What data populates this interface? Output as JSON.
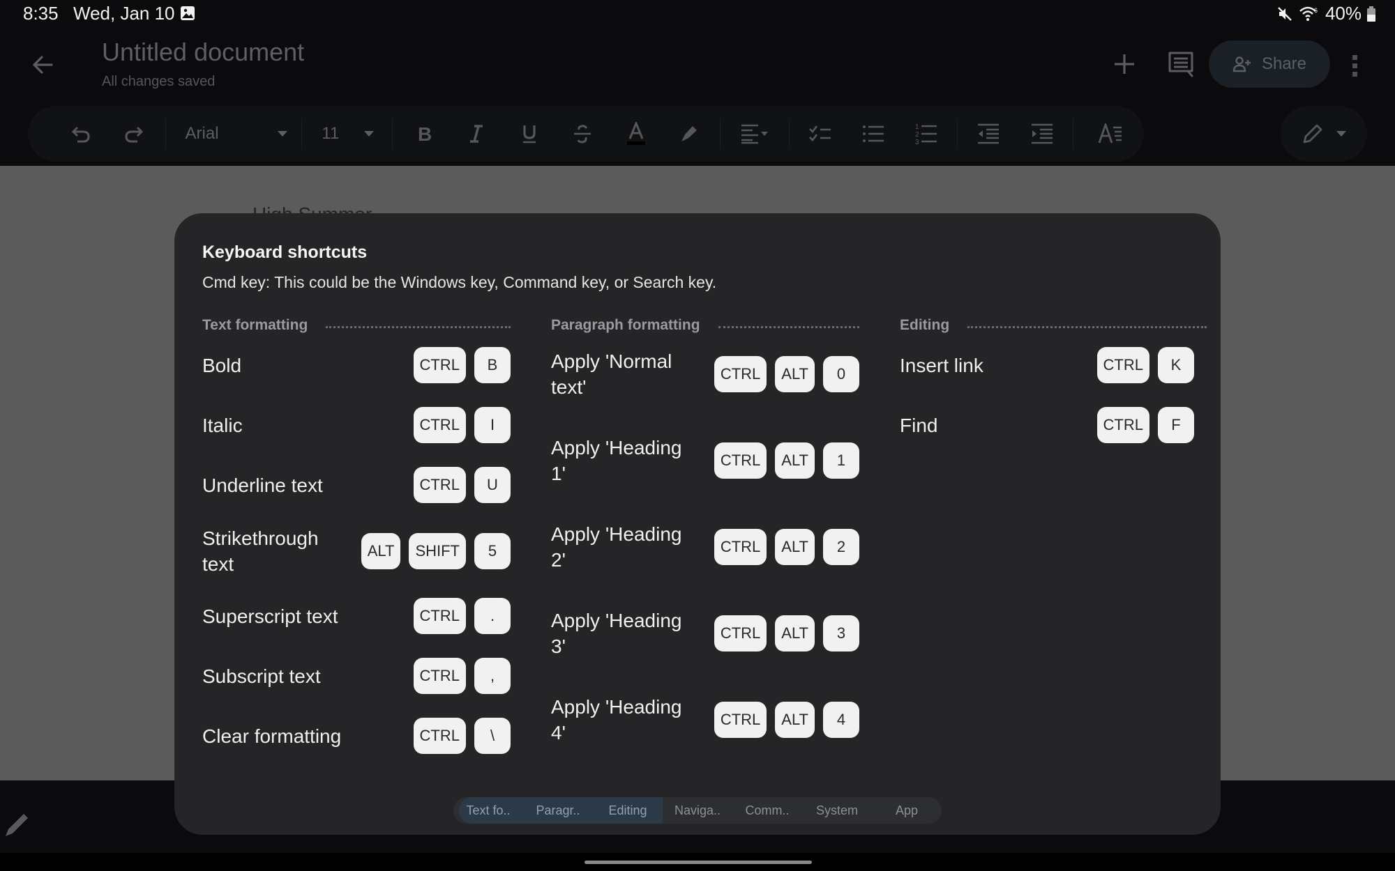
{
  "status_bar": {
    "time": "8:35",
    "date": "Wed, Jan 10",
    "notification_icon": "gallery-icon",
    "mute_icon": "mute-icon",
    "wifi_icon": "wifi-6-icon",
    "battery": "40%"
  },
  "app_bar": {
    "title": "Untitled document",
    "save_status": "All changes saved",
    "share_label": "Share"
  },
  "toolbar": {
    "font": "Arial",
    "font_size": "11",
    "buttons": [
      "undo",
      "redo",
      "bold",
      "italic",
      "underline",
      "strikethrough",
      "text-color",
      "highlight",
      "align",
      "checklist",
      "bulleted-list",
      "numbered-list",
      "decrease-indent",
      "increase-indent",
      "text-format",
      "edit-mode"
    ]
  },
  "document": {
    "first_line": "High Summer"
  },
  "dialog": {
    "title": "Keyboard shortcuts",
    "subtitle": "Cmd key: This could be the Windows key, Command key, or Search key.",
    "sections": [
      {
        "heading": "Text formatting",
        "shortcuts": [
          {
            "label": "Bold",
            "keys": [
              "CTRL",
              "B"
            ]
          },
          {
            "label": "Italic",
            "keys": [
              "CTRL",
              "I"
            ]
          },
          {
            "label": "Underline text",
            "keys": [
              "CTRL",
              "U"
            ]
          },
          {
            "label": "Strikethrough text",
            "keys": [
              "ALT",
              "SHIFT",
              "5"
            ]
          },
          {
            "label": "Superscript text",
            "keys": [
              "CTRL",
              "."
            ]
          },
          {
            "label": "Subscript text",
            "keys": [
              "CTRL",
              ","
            ]
          },
          {
            "label": "Clear formatting",
            "keys": [
              "CTRL",
              "\\"
            ]
          }
        ]
      },
      {
        "heading": "Paragraph formatting",
        "shortcuts": [
          {
            "label": "Apply 'Normal text'",
            "keys": [
              "CTRL",
              "ALT",
              "0"
            ]
          },
          {
            "label": "Apply 'Heading 1'",
            "keys": [
              "CTRL",
              "ALT",
              "1"
            ]
          },
          {
            "label": "Apply 'Heading 2'",
            "keys": [
              "CTRL",
              "ALT",
              "2"
            ]
          },
          {
            "label": "Apply 'Heading 3'",
            "keys": [
              "CTRL",
              "ALT",
              "3"
            ]
          },
          {
            "label": "Apply 'Heading 4'",
            "keys": [
              "CTRL",
              "ALT",
              "4"
            ]
          }
        ]
      },
      {
        "heading": "Editing",
        "shortcuts": [
          {
            "label": "Insert link",
            "keys": [
              "CTRL",
              "K"
            ]
          },
          {
            "label": "Find",
            "keys": [
              "CTRL",
              "F"
            ]
          }
        ]
      }
    ],
    "tabs": [
      {
        "label": "Text fo..",
        "active": true
      },
      {
        "label": "Paragr..",
        "active": true
      },
      {
        "label": "Editing",
        "active": true
      },
      {
        "label": "Naviga..",
        "active": false
      },
      {
        "label": "Comm..",
        "active": false
      },
      {
        "label": "System",
        "active": false
      },
      {
        "label": "App",
        "active": false
      }
    ]
  }
}
